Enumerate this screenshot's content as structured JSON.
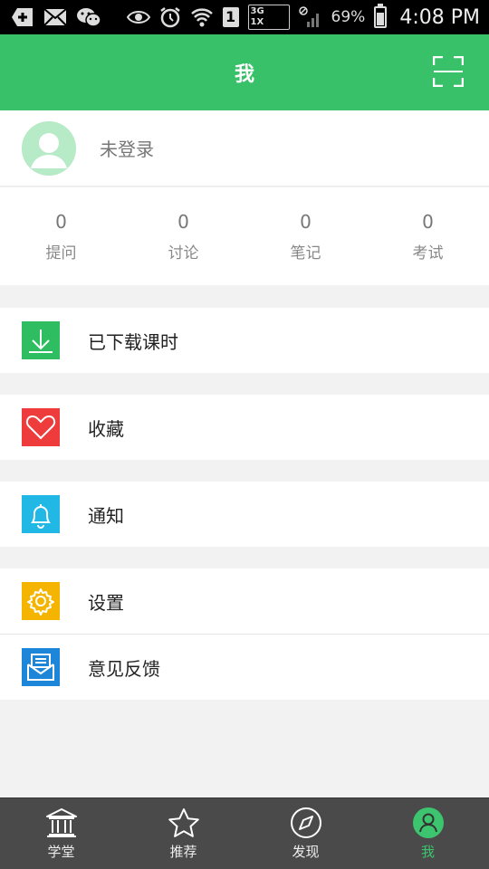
{
  "status_bar": {
    "sim_slot": "1",
    "network": "3G\n1X",
    "battery": "69%",
    "time": "4:08 PM"
  },
  "header": {
    "title": "我"
  },
  "profile": {
    "name": "未登录"
  },
  "stats": [
    {
      "value": "0",
      "label": "提问"
    },
    {
      "value": "0",
      "label": "讨论"
    },
    {
      "value": "0",
      "label": "笔记"
    },
    {
      "value": "0",
      "label": "考试"
    }
  ],
  "menu": [
    {
      "label": "已下载课时",
      "icon": "download-icon",
      "color": "#2fbd61"
    },
    {
      "label": "收藏",
      "icon": "heart-icon",
      "color": "#ee3c3c"
    },
    {
      "label": "通知",
      "icon": "bell-icon",
      "color": "#22b8e6"
    },
    {
      "label": "设置",
      "icon": "gear-icon",
      "color": "#f4b400"
    },
    {
      "label": "意见反馈",
      "icon": "mail-icon",
      "color": "#1e86d9"
    }
  ],
  "bottom_nav": [
    {
      "label": "学堂",
      "icon": "school-icon"
    },
    {
      "label": "推荐",
      "icon": "star-icon"
    },
    {
      "label": "发现",
      "icon": "compass-icon"
    },
    {
      "label": "我",
      "icon": "user-icon",
      "active": true
    }
  ],
  "colors": {
    "accent": "#39c16a",
    "nav_bg": "#4a4a4a"
  }
}
